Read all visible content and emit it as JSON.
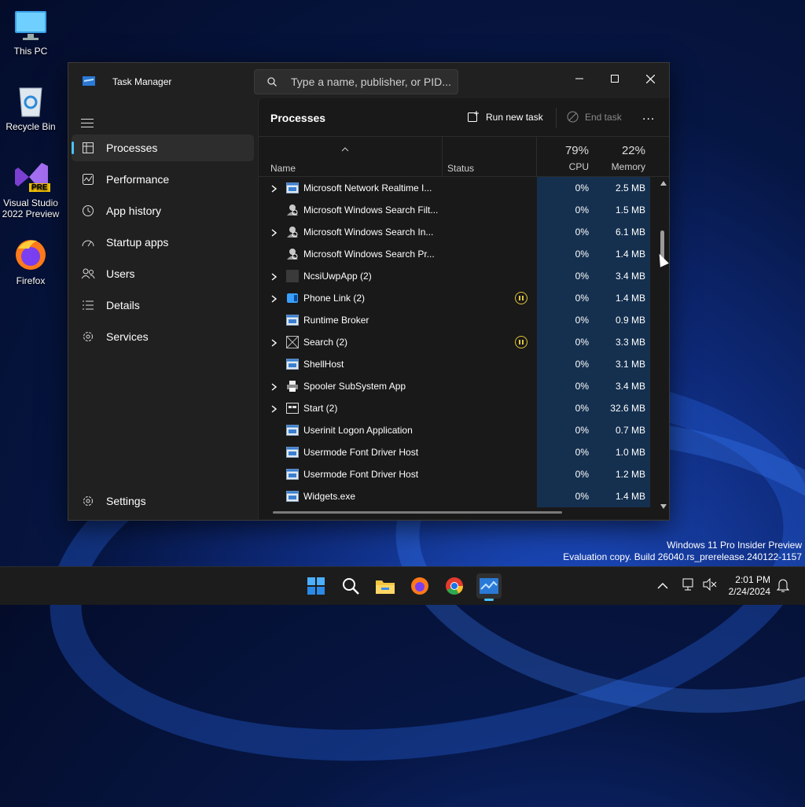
{
  "desktop": {
    "icons": [
      {
        "label": "This PC"
      },
      {
        "label": "Recycle Bin"
      },
      {
        "label": "Visual Studio 2022 Preview",
        "badge": "PRE"
      },
      {
        "label": "Firefox"
      }
    ]
  },
  "window": {
    "title": "Task Manager",
    "search_placeholder": "Type a name, publisher, or PID..."
  },
  "nav": {
    "items": [
      {
        "label": "Processes",
        "icon": "processes-grid-icon",
        "active": true
      },
      {
        "label": "Performance",
        "icon": "performance-chart-icon"
      },
      {
        "label": "App history",
        "icon": "history-clock-icon"
      },
      {
        "label": "Startup apps",
        "icon": "startup-gauge-icon"
      },
      {
        "label": "Users",
        "icon": "users-icon"
      },
      {
        "label": "Details",
        "icon": "details-list-icon"
      },
      {
        "label": "Services",
        "icon": "services-gear-icon"
      }
    ],
    "settings": "Settings"
  },
  "toolbar": {
    "page_title": "Processes",
    "run_new_task": "Run new task",
    "end_task": "End task",
    "more": "..."
  },
  "columns": {
    "name": "Name",
    "status": "Status",
    "cpu_pct": "79%",
    "cpu": "CPU",
    "memory_pct": "22%",
    "memory": "Memory"
  },
  "processes": [
    {
      "name": "Microsoft Network Realtime I...",
      "expandable": true,
      "icon": "app-window-icon",
      "status": "",
      "cpu": "0%",
      "memory": "2.5 MB"
    },
    {
      "name": "Microsoft Windows Search Filt...",
      "expandable": false,
      "icon": "search-user-icon",
      "status": "",
      "cpu": "0%",
      "memory": "1.5 MB"
    },
    {
      "name": "Microsoft Windows Search In...",
      "expandable": true,
      "icon": "search-user-icon",
      "status": "",
      "cpu": "0%",
      "memory": "6.1 MB"
    },
    {
      "name": "Microsoft Windows Search Pr...",
      "expandable": false,
      "icon": "search-user-icon",
      "status": "",
      "cpu": "0%",
      "memory": "1.4 MB"
    },
    {
      "name": "NcsiUwpApp (2)",
      "expandable": true,
      "icon": "blank-app-icon",
      "status": "",
      "cpu": "0%",
      "memory": "3.4 MB"
    },
    {
      "name": "Phone Link (2)",
      "expandable": true,
      "icon": "phone-link-icon",
      "status": "suspended",
      "cpu": "0%",
      "memory": "1.4 MB"
    },
    {
      "name": "Runtime Broker",
      "expandable": false,
      "icon": "app-window-icon",
      "status": "",
      "cpu": "0%",
      "memory": "0.9 MB"
    },
    {
      "name": "Search (2)",
      "expandable": true,
      "icon": "search-app-icon",
      "status": "suspended",
      "cpu": "0%",
      "memory": "3.3 MB"
    },
    {
      "name": "ShellHost",
      "expandable": false,
      "icon": "app-window-icon",
      "status": "",
      "cpu": "0%",
      "memory": "3.1 MB"
    },
    {
      "name": "Spooler SubSystem App",
      "expandable": true,
      "icon": "printer-icon",
      "status": "",
      "cpu": "0%",
      "memory": "3.4 MB"
    },
    {
      "name": "Start (2)",
      "expandable": true,
      "icon": "start-app-icon",
      "status": "",
      "cpu": "0%",
      "memory": "32.6 MB"
    },
    {
      "name": "Userinit Logon Application",
      "expandable": false,
      "icon": "app-window-icon",
      "status": "",
      "cpu": "0%",
      "memory": "0.7 MB"
    },
    {
      "name": "Usermode Font Driver Host",
      "expandable": false,
      "icon": "app-window-icon",
      "status": "",
      "cpu": "0%",
      "memory": "1.0 MB"
    },
    {
      "name": "Usermode Font Driver Host",
      "expandable": false,
      "icon": "app-window-icon",
      "status": "",
      "cpu": "0%",
      "memory": "1.2 MB"
    },
    {
      "name": "Widgets.exe",
      "expandable": false,
      "icon": "app-window-icon",
      "status": "",
      "cpu": "0%",
      "memory": "1.4 MB"
    }
  ],
  "watermark": {
    "line1": "Windows 11 Pro Insider Preview",
    "line2": "Evaluation copy. Build 26040.rs_prerelease.240122-1157"
  },
  "taskbar": {
    "apps": [
      "start-icon",
      "search-icon",
      "file-explorer-icon",
      "firefox-icon",
      "chrome-icon",
      "task-manager-icon"
    ],
    "time": "2:01 PM",
    "date": "2/24/2024"
  },
  "colors": {
    "accent": "#4cc2ff",
    "heat": "#15304f",
    "warning": "#e0c43a"
  }
}
